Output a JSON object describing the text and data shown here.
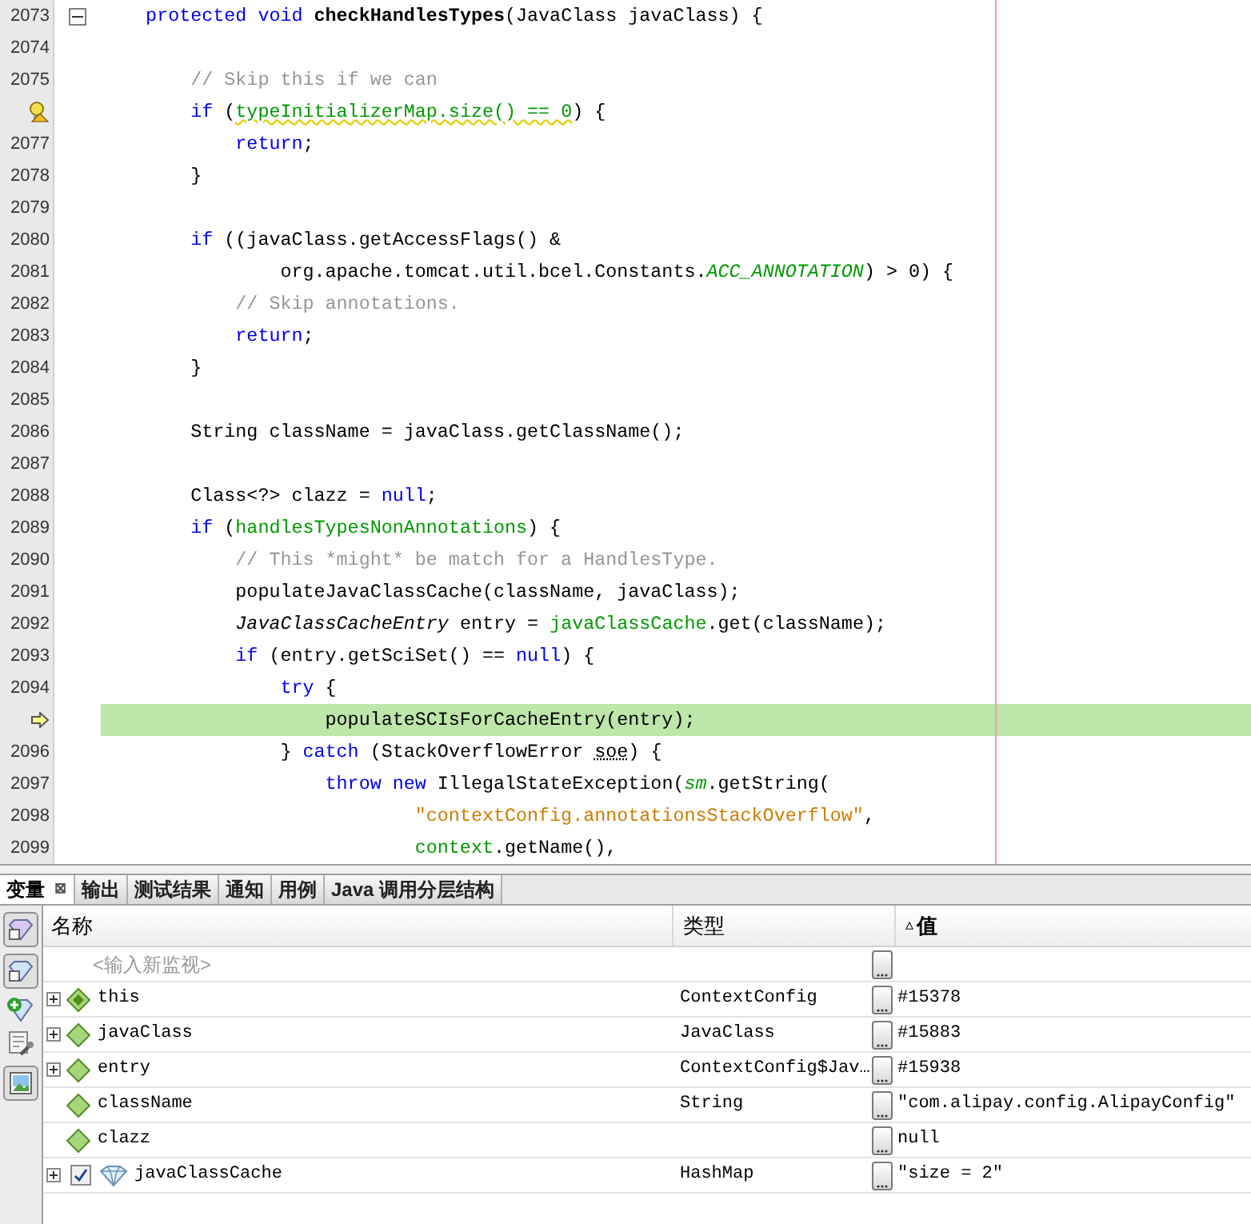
{
  "editor": {
    "lines": [
      {
        "number": "2073",
        "fold": true,
        "segments": [
          {
            "kind": "keyword",
            "text": "    protected void "
          },
          {
            "kind": "bold",
            "text": "checkHandlesTypes"
          },
          {
            "kind": "plain",
            "text": "(JavaClass javaClass) {"
          }
        ]
      },
      {
        "number": "2074"
      },
      {
        "number": "2075",
        "segments": [
          {
            "kind": "comment",
            "text": "        // Skip this if we can"
          }
        ]
      },
      {
        "kind": "warning",
        "segments": [
          {
            "kind": "keyword",
            "text": "        if "
          },
          {
            "kind": "plain",
            "text": "("
          },
          {
            "kind": "field-warning",
            "text": "typeInitializerMap.size() == 0"
          },
          {
            "kind": "plain",
            "text": ") {"
          }
        ]
      },
      {
        "number": "2077",
        "segments": [
          {
            "kind": "keyword",
            "text": "            return"
          },
          {
            "kind": "plain",
            "text": ";"
          }
        ]
      },
      {
        "number": "2078",
        "segments": [
          {
            "kind": "plain",
            "text": "        }"
          }
        ]
      },
      {
        "number": "2079"
      },
      {
        "number": "2080",
        "segments": [
          {
            "kind": "keyword",
            "text": "        if "
          },
          {
            "kind": "plain",
            "text": "((javaClass.getAccessFlags() &"
          }
        ]
      },
      {
        "number": "2081",
        "segments": [
          {
            "kind": "plain",
            "text": "                org.apache.tomcat.util.bcel.Constants."
          },
          {
            "kind": "static",
            "text": "ACC_ANNOTATION"
          },
          {
            "kind": "plain",
            "text": ") > 0) {"
          }
        ]
      },
      {
        "number": "2082",
        "segments": [
          {
            "kind": "comment",
            "text": "            // Skip annotations."
          }
        ]
      },
      {
        "number": "2083",
        "segments": [
          {
            "kind": "keyword",
            "text": "            return"
          },
          {
            "kind": "plain",
            "text": ";"
          }
        ]
      },
      {
        "number": "2084",
        "segments": [
          {
            "kind": "plain",
            "text": "        }"
          }
        ]
      },
      {
        "number": "2085"
      },
      {
        "number": "2086",
        "segments": [
          {
            "kind": "plain",
            "text": "        String className = javaClass.getClassName();"
          }
        ]
      },
      {
        "number": "2087"
      },
      {
        "number": "2088",
        "segments": [
          {
            "kind": "plain",
            "text": "        Class<?> clazz = "
          },
          {
            "kind": "keyword",
            "text": "null"
          },
          {
            "kind": "plain",
            "text": ";"
          }
        ]
      },
      {
        "number": "2089",
        "segments": [
          {
            "kind": "keyword",
            "text": "        if "
          },
          {
            "kind": "plain",
            "text": "("
          },
          {
            "kind": "field",
            "text": "handlesTypesNonAnnotations"
          },
          {
            "kind": "plain",
            "text": ") {"
          }
        ]
      },
      {
        "number": "2090",
        "segments": [
          {
            "kind": "comment",
            "text": "            // This *might* be match for a HandlesType."
          }
        ]
      },
      {
        "number": "2091",
        "segments": [
          {
            "kind": "plain",
            "text": "            populateJavaClassCache(className, javaClass);"
          }
        ]
      },
      {
        "number": "2092",
        "segments": [
          {
            "kind": "italic",
            "text": "            JavaClassCacheEntry"
          },
          {
            "kind": "plain",
            "text": " entry = "
          },
          {
            "kind": "field",
            "text": "javaClassCache"
          },
          {
            "kind": "plain",
            "text": ".get(className);"
          }
        ]
      },
      {
        "number": "2093",
        "segments": [
          {
            "kind": "keyword",
            "text": "            if "
          },
          {
            "kind": "plain",
            "text": "(entry.getSciSet() == "
          },
          {
            "kind": "keyword",
            "text": "null"
          },
          {
            "kind": "plain",
            "text": ") {"
          }
        ]
      },
      {
        "number": "2094",
        "segments": [
          {
            "kind": "keyword",
            "text": "                try "
          },
          {
            "kind": "plain",
            "text": "{"
          }
        ]
      },
      {
        "kind": "current",
        "segments": [
          {
            "kind": "plain",
            "text": "                    populateSCIsForCacheEntry(entry);"
          }
        ]
      },
      {
        "number": "2096",
        "segments": [
          {
            "kind": "plain",
            "text": "                } "
          },
          {
            "kind": "keyword",
            "text": "catch "
          },
          {
            "kind": "plain",
            "text": "(StackOverflowError "
          },
          {
            "kind": "unused",
            "text": "soe"
          },
          {
            "kind": "plain",
            "text": ") {"
          }
        ]
      },
      {
        "number": "2097",
        "segments": [
          {
            "kind": "keyword",
            "text": "                    throw new "
          },
          {
            "kind": "plain",
            "text": "IllegalStateException("
          },
          {
            "kind": "static",
            "text": "sm"
          },
          {
            "kind": "plain",
            "text": ".getString("
          }
        ]
      },
      {
        "number": "2098",
        "segments": [
          {
            "kind": "string",
            "text": "                            \"contextConfig.annotationsStackOverflow\""
          },
          {
            "kind": "plain",
            "text": ","
          }
        ]
      },
      {
        "number": "2099",
        "segments": [
          {
            "kind": "field",
            "text": "                            context"
          },
          {
            "kind": "plain",
            "text": ".getName(),"
          }
        ]
      }
    ]
  },
  "panel": {
    "tabs": [
      {
        "label": "变量",
        "selected": true,
        "close": "⊠"
      },
      {
        "label": "输出",
        "selected": false
      },
      {
        "label": "测试结果",
        "selected": false
      },
      {
        "label": "通知",
        "selected": false
      },
      {
        "label": "用例",
        "selected": false
      },
      {
        "label": "Java 调用分层结构",
        "selected": false
      }
    ],
    "columns": [
      {
        "label": "名称"
      },
      {
        "label": "类型"
      },
      {
        "label": "值",
        "sort": "▵"
      }
    ],
    "new_watch": {
      "placeholder": "<输入新监视>"
    },
    "variables": [
      {
        "kind": "this",
        "expandable": true,
        "name": "this",
        "type": "ContextConfig",
        "value": "#15378"
      },
      {
        "kind": "local",
        "expandable": true,
        "name": "javaClass",
        "type": "JavaClass",
        "value": "#15883"
      },
      {
        "kind": "local",
        "expandable": true,
        "name": "entry",
        "type": "ContextConfig$Jav…",
        "value": "#15938"
      },
      {
        "kind": "local",
        "expandable": false,
        "name": "className",
        "type": "String",
        "value": "\"com.alipay.config.AlipayConfig\""
      },
      {
        "kind": "local",
        "expandable": false,
        "name": "clazz",
        "value": "null"
      },
      {
        "kind": "watch",
        "expandable": true,
        "checked": true,
        "name": "javaClassCache",
        "type": "HashMap",
        "value": "\"size = 2\""
      }
    ]
  }
}
